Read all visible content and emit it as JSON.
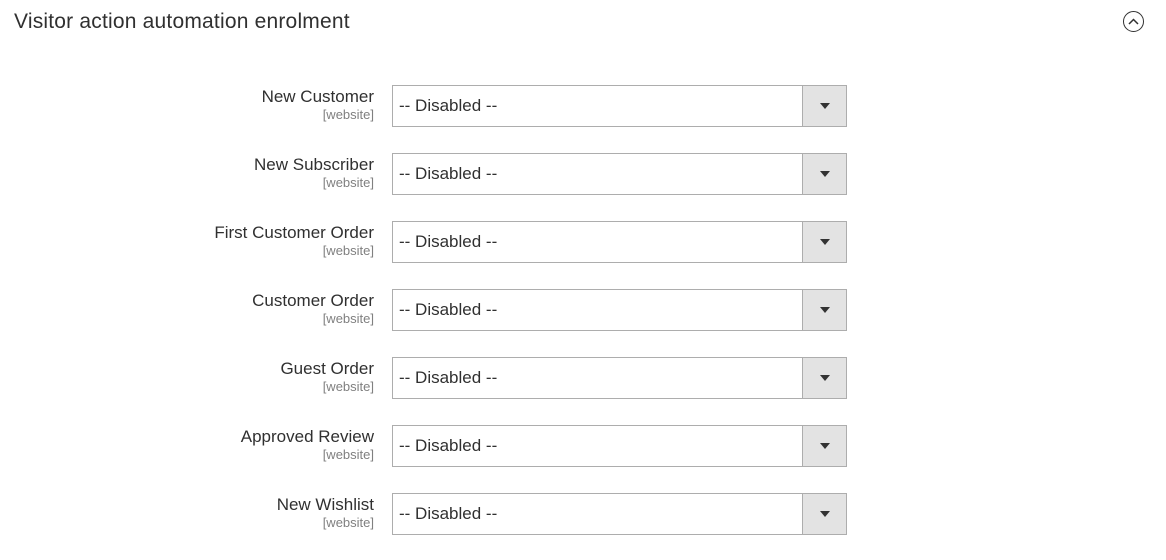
{
  "section": {
    "title": "Visitor action automation enrolment",
    "toggle_icon": "chevron-up-circle-icon"
  },
  "fields": [
    {
      "label": "New Customer",
      "scope": "[website]",
      "value": "-- Disabled --"
    },
    {
      "label": "New Subscriber",
      "scope": "[website]",
      "value": "-- Disabled --"
    },
    {
      "label": "First Customer Order",
      "scope": "[website]",
      "value": "-- Disabled --"
    },
    {
      "label": "Customer Order",
      "scope": "[website]",
      "value": "-- Disabled --"
    },
    {
      "label": "Guest Order",
      "scope": "[website]",
      "value": "-- Disabled --"
    },
    {
      "label": "Approved Review",
      "scope": "[website]",
      "value": "-- Disabled --"
    },
    {
      "label": "New Wishlist",
      "scope": "[website]",
      "value": "-- Disabled --"
    }
  ],
  "colors": {
    "text": "#303030",
    "scope_text": "#808080",
    "select_border": "#adadad",
    "arrow_button_bg": "#e3e3e3"
  }
}
